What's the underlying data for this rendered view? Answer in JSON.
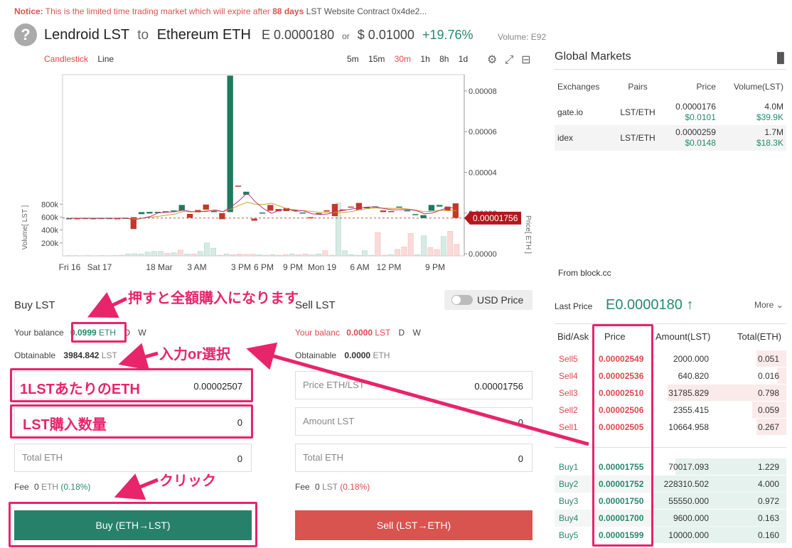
{
  "notice": {
    "label": "Notice:",
    "text1": "This is the limited time trading market which will expire after",
    "days": "88 days",
    "text2": "LST Website",
    "text3": "Contract 0x4de2..."
  },
  "header": {
    "icon": "question-icon",
    "base": "Lendroid LST",
    "to": "to",
    "quote": "Ethereum ETH",
    "price_eth": "E 0.0000180",
    "or": "or",
    "price_usd": "$ 0.01000",
    "change": "+19.76%",
    "volume": "Volume: E92"
  },
  "chart_controls": {
    "types": [
      "Candlestick",
      "Line"
    ],
    "timeframes": [
      "5m",
      "15m",
      "30m",
      "1h",
      "8h",
      "1d"
    ],
    "active_timeframe": "30m"
  },
  "chart_data": {
    "type": "candlestick",
    "title": "",
    "price_axis_label": "Price[ ETH ]",
    "volume_axis_label": "Volume[ LST ]",
    "y_ticks": [
      "0.00008",
      "0.00006",
      "0.00004",
      "0.00002",
      "0.00000"
    ],
    "volume_ticks": [
      "800k",
      "600k",
      "400k",
      "200k"
    ],
    "x_ticks": [
      "Fri 16",
      "Sat 17",
      "18 Mar",
      "3 AM",
      "3 PM",
      "6 PM",
      "9 PM",
      "Mon 19",
      "6 AM",
      "12 PM",
      "9 PM"
    ],
    "last_price_tag": "0.00001756",
    "ylim": [
      -1e-06,
      8.8e-05
    ],
    "candles": [
      {
        "o": 1.75e-05,
        "c": 1.75e-05
      },
      {
        "o": 1.75e-05,
        "c": 1.74e-05
      },
      {
        "o": 1.74e-05,
        "c": 1.76e-05
      },
      {
        "o": 1.74e-05,
        "c": 1.75e-05
      },
      {
        "o": 1.75e-05,
        "c": 1.76e-05
      },
      {
        "o": 1.75e-05,
        "c": 1.76e-05
      },
      {
        "o": 1.75e-05,
        "c": 1.74e-05
      },
      {
        "o": 1.75e-05,
        "c": 1.77e-05
      },
      {
        "o": 1.8e-05,
        "c": 1.22e-05
      },
      {
        "o": 1.95e-05,
        "c": 2.05e-05
      },
      {
        "o": 1.98e-05,
        "c": 2.06e-05
      },
      {
        "o": 2e-05,
        "c": 2.06e-05
      },
      {
        "o": 2.05e-05,
        "c": 2.09e-05
      },
      {
        "o": 2.08e-05,
        "c": 2.13e-05
      },
      {
        "o": 2.12e-05,
        "c": 2.4e-05
      },
      {
        "o": 1.96e-05,
        "c": 1.77e-05
      },
      {
        "o": 2.15e-05,
        "c": 2.04e-05
      },
      {
        "o": 2.42e-05,
        "c": 2.17e-05
      },
      {
        "o": 2.05e-05,
        "c": 2.1e-05
      },
      {
        "o": 2e-05,
        "c": 1.7e-05
      },
      {
        "o": 2.05e-05,
        "c": 8.75e-05
      },
      {
        "o": 3.35e-05,
        "c": 3.3e-05
      },
      {
        "o": 2.9e-05,
        "c": 3.05e-05
      },
      {
        "o": 1.73e-05,
        "c": 1.63e-05
      },
      {
        "o": 2.02e-05,
        "c": 2.03e-05
      },
      {
        "o": 2.4e-05,
        "c": 2.12e-05
      },
      {
        "o": 2.2e-05,
        "c": 2.09e-05
      },
      {
        "o": 2.25e-05,
        "c": 2.1e-05
      },
      {
        "o": 2.15e-05,
        "c": 2.11e-05
      },
      {
        "o": 2e-05,
        "c": 2.03e-05
      },
      {
        "o": 1.8e-05,
        "c": 1.75e-05
      },
      {
        "o": 1.98e-05,
        "c": 2e-05
      },
      {
        "o": 2.14e-05,
        "c": 2.08e-05
      },
      {
        "o": 2.45e-05,
        "c": 1.85e-05
      },
      {
        "o": 2.18e-05,
        "c": 2.14e-05
      },
      {
        "o": 2.32e-05,
        "c": 2.29e-05
      },
      {
        "o": 2.5e-05,
        "c": 2.15e-05
      },
      {
        "o": 2.24e-05,
        "c": 2.3e-05
      },
      {
        "o": 2.28e-05,
        "c": 2.33e-05
      },
      {
        "o": 2.13e-05,
        "c": 2.05e-05
      },
      {
        "o": 2.1e-05,
        "c": 2.08e-05
      },
      {
        "o": 2.3e-05,
        "c": 2.32e-05
      },
      {
        "o": 2.12e-05,
        "c": 2.14e-05
      },
      {
        "o": 1.92e-05,
        "c": 1.95e-05
      },
      {
        "o": 1.75e-05,
        "c": 1.9e-05
      },
      {
        "o": 2.12e-05,
        "c": 2.4e-05
      },
      {
        "o": 2.32e-05,
        "c": 2.4e-05
      },
      {
        "o": 2.32e-05,
        "c": 2.12e-05
      },
      {
        "o": 2.48e-05,
        "c": 1.76e-05
      }
    ],
    "volumes": [
      5000,
      5000,
      3000,
      5000,
      3000,
      5000,
      4000,
      5000,
      10000,
      30000,
      35000,
      30000,
      60000,
      70000,
      70000,
      40000,
      50000,
      90000,
      30000,
      30000,
      70000,
      200000,
      120000,
      10000,
      30000,
      20000,
      30000,
      25000,
      25000,
      20000,
      10000,
      20000,
      10000,
      20000,
      30000,
      20000,
      30000,
      15000,
      30000,
      80000,
      10000,
      820000,
      80000,
      20000,
      10000,
      80000,
      10000,
      360000,
      10000,
      20000,
      100000,
      140000,
      350000,
      20000,
      310000,
      130000,
      100000,
      300000,
      380000,
      180000
    ],
    "volume_up": [
      false,
      false,
      true,
      false,
      true,
      true,
      false,
      true,
      false,
      true,
      true,
      true,
      true,
      true,
      true,
      false,
      true,
      false,
      true,
      false,
      true,
      true,
      true,
      false,
      true,
      false,
      false,
      false,
      false,
      true,
      false,
      true,
      false,
      false,
      true,
      false,
      false,
      true,
      true,
      false,
      false,
      true,
      true,
      true,
      true,
      true,
      true,
      false,
      false,
      true,
      false,
      false,
      false,
      true,
      true,
      false,
      false,
      true,
      false,
      false
    ]
  },
  "global_markets": {
    "title": "Global Markets",
    "headers": [
      "Exchanges",
      "Pairs",
      "Price",
      "Volume(LST)"
    ],
    "rows": [
      {
        "exchange": "gate.io",
        "pair": "LST/ETH",
        "price": "0.0000176",
        "price_usd": "$0.0101",
        "volume": "4.0M",
        "volume_usd": "$39.9K"
      },
      {
        "exchange": "idex",
        "pair": "LST/ETH",
        "price": "0.0000259",
        "price_usd": "$0.0148",
        "volume": "1.7M",
        "volume_usd": "$18.3K"
      }
    ],
    "from": "From block.cc"
  },
  "buy": {
    "title": "Buy LST",
    "balance_label": "Your balance",
    "balance_value": "0.0999",
    "balance_unit": "ETH",
    "d": "D",
    "w": "W",
    "obtainable_label": "Obtainable",
    "obtainable_value": "3984.842",
    "obtainable_unit": "LST",
    "price_value": "0.00002507",
    "amount_value": "0",
    "total_placeholder": "Total ETH",
    "total_value": "0",
    "fee_label": "Fee",
    "fee_value": "0",
    "fee_unit": "ETH",
    "fee_pct": "(0.18%)",
    "button": "Buy (ETH→LST)"
  },
  "sell": {
    "title": "Sell LST",
    "balance_label": "Your balanc",
    "balance_value": "0.0000",
    "balance_unit": "LST",
    "d": "D",
    "w": "W",
    "obtainable_label": "Obtainable",
    "obtainable_value": "0.0000",
    "obtainable_unit": "ETH",
    "price_placeholder": "Price ETH/LST",
    "price_value": "0.00001756",
    "amount_placeholder": "Amount LST",
    "amount_value": "0",
    "total_placeholder": "Total ETH",
    "total_value": "0",
    "fee_label": "Fee",
    "fee_value": "0",
    "fee_unit": "LST",
    "fee_pct": "(0.18%)",
    "button": "Sell (LST→ETH)"
  },
  "usd_toggle": {
    "label": "USD Price"
  },
  "orderbook": {
    "last_price_label": "Last Price",
    "last_price": "E0.0000180 ↑",
    "more": "More",
    "headers": [
      "Bid/Ask",
      "Price",
      "Amount(LST)",
      "Total(ETH)"
    ],
    "asks": [
      {
        "label": "Sell5",
        "price": "0.00002549",
        "amount": "2000.000",
        "total": "0.051",
        "depth": 0.22
      },
      {
        "label": "Sell4",
        "price": "0.00002536",
        "amount": "640.820",
        "total": "0.016",
        "depth": 0.07
      },
      {
        "label": "Sell3",
        "price": "0.00002510",
        "amount": "31785.829",
        "total": "0.798",
        "depth": 0.88
      },
      {
        "label": "Sell2",
        "price": "0.00002506",
        "amount": "2355.415",
        "total": "0.059",
        "depth": 0.25
      },
      {
        "label": "Sell1",
        "price": "0.00002505",
        "amount": "10664.958",
        "total": "0.267",
        "depth": 0.22
      }
    ],
    "bids": [
      {
        "label": "Buy1",
        "price": "0.00001755",
        "amount": "70017.093",
        "total": "1.229",
        "depth": 0.82
      },
      {
        "label": "Buy2",
        "price": "0.00001752",
        "amount": "228310.502",
        "total": "4.000",
        "depth": 1.0
      },
      {
        "label": "Buy3",
        "price": "0.00001750",
        "amount": "55550.000",
        "total": "0.972",
        "depth": 1.0
      },
      {
        "label": "Buy4",
        "price": "0.00001700",
        "amount": "9600.000",
        "total": "0.163",
        "depth": 1.0
      },
      {
        "label": "Buy5",
        "price": "0.00001599",
        "amount": "10000.000",
        "total": "0.160",
        "depth": 1.0
      }
    ]
  },
  "annotations": {
    "full_buy": "押すと全額購入になります",
    "input_select": "入力or選択",
    "eth_per_lst": "1LSTあたりのETH",
    "lst_amount": "LST購入数量",
    "click": "クリック"
  },
  "colors": {
    "green": "#27896d",
    "red": "#e0474d",
    "annotation": "#e8246b",
    "buy_button": "#27806a",
    "sell_button": "#d9534f"
  }
}
